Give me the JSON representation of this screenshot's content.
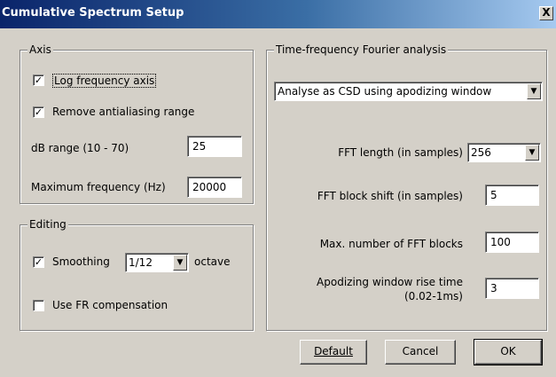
{
  "window": {
    "title": "Cumulative Spectrum Setup",
    "close_glyph": "X"
  },
  "axis": {
    "legend": "Axis",
    "log_frequency": {
      "label": "Log frequency axis",
      "checked": true
    },
    "remove_antialiasing": {
      "label": "Remove antialiasing range",
      "checked": true
    },
    "db_range": {
      "label": "dB range (10 - 70)",
      "value": "25"
    },
    "max_frequency": {
      "label": "Maximum frequency (Hz)",
      "value": "20000"
    }
  },
  "editing": {
    "legend": "Editing",
    "smoothing": {
      "label": "Smoothing",
      "checked": true,
      "value": "1/12",
      "suffix": "octave"
    },
    "fr_compensation": {
      "label": "Use FR compensation",
      "checked": false
    }
  },
  "tf": {
    "legend": "Time-frequency Fourier analysis",
    "mode": "Analyse as CSD using apodizing window",
    "fft_length": {
      "label": "FFT length (in samples)",
      "value": "256"
    },
    "fft_shift": {
      "label": "FFT block shift (in samples)",
      "value": "5"
    },
    "max_blocks": {
      "label": "Max. number of FFT blocks",
      "value": "100"
    },
    "rise_time": {
      "label_line1": "Apodizing window rise time",
      "label_line2": "(0.02-1ms)",
      "value": "3"
    }
  },
  "buttons": {
    "default": "Default",
    "cancel": "Cancel",
    "ok": "OK"
  },
  "glyphs": {
    "check": "✓",
    "dropdown": "▼"
  }
}
